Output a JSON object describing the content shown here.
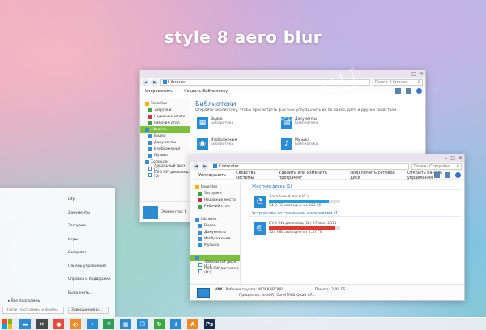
{
  "headline": "style 8 aero blur",
  "watermark": "All4os.RU",
  "libraries_window": {
    "address": "Libraries",
    "search_placeholder": "Поиск: Libraries",
    "commands": [
      "Упорядочить",
      "Создать библиотеку"
    ],
    "nav": [
      {
        "label": "Favorites",
        "icon": "star-icon",
        "level": 0
      },
      {
        "label": "Загрузки",
        "icon": "download-icon",
        "level": 1
      },
      {
        "label": "Недавние места",
        "icon": "recent-places-icon",
        "level": 1
      },
      {
        "label": "Рабочий стол",
        "icon": "desktop-icon",
        "level": 1
      },
      {
        "label": "Libraries",
        "icon": "library-icon",
        "level": 0,
        "selected": true
      },
      {
        "label": "Видео",
        "icon": "video-icon",
        "level": 1
      },
      {
        "label": "Документы",
        "icon": "documents-icon",
        "level": 1
      },
      {
        "label": "Изображения",
        "icon": "pictures-icon",
        "level": 1
      },
      {
        "label": "Музыка",
        "icon": "music-icon",
        "level": 1
      },
      {
        "label": "Computer",
        "icon": "computer-icon",
        "level": 0
      },
      {
        "label": "Локальный диск (C:)",
        "icon": "drive-icon",
        "level": 1
      },
      {
        "label": "DVD RW дисковод (D:)",
        "icon": "dvd-icon",
        "level": 1
      }
    ],
    "heading": "Библиотеки",
    "description": "Откройте библиотеку, чтобы просмотреть файлы и упорядочить их по папке, дате и другим свойствам.",
    "tiles": [
      {
        "name": "Видео",
        "type": "Библиотека",
        "icon": "video-icon",
        "glyph": "▦"
      },
      {
        "name": "Документы",
        "type": "Библиотека",
        "icon": "documents-icon",
        "glyph": "▤"
      },
      {
        "name": "Изображения",
        "type": "Библиотека",
        "icon": "pictures-icon",
        "glyph": "◉"
      },
      {
        "name": "Музыка",
        "type": "Библиотека",
        "icon": "music-icon",
        "glyph": "♪"
      }
    ],
    "details": "Элементов: 4"
  },
  "computer_window": {
    "address": "Computer",
    "search_placeholder": "Поиск: Computer",
    "commands": [
      "Упорядочить",
      "Свойства системы",
      "Удалить или изменить программу",
      "Подключить сетевой диск",
      "Открыть панель управления"
    ],
    "nav": [
      {
        "label": "Favorites",
        "icon": "star-icon",
        "level": 0
      },
      {
        "label": "Загрузки",
        "icon": "download-icon",
        "level": 1
      },
      {
        "label": "Недавние места",
        "icon": "recent-places-icon",
        "level": 1
      },
      {
        "label": "Рабочий стол",
        "icon": "desktop-icon",
        "level": 1
      },
      {
        "label": "",
        "icon": "",
        "level": 0
      },
      {
        "label": "Libraries",
        "icon": "library-icon",
        "level": 0
      },
      {
        "label": "Видео",
        "icon": "video-icon",
        "level": 1
      },
      {
        "label": "Документы",
        "icon": "documents-icon",
        "level": 1
      },
      {
        "label": "Изображения",
        "icon": "pictures-icon",
        "level": 1
      },
      {
        "label": "Музыка",
        "icon": "music-icon",
        "level": 1
      },
      {
        "label": "",
        "icon": "",
        "level": 0
      },
      {
        "label": "",
        "icon": "computer-icon",
        "level": 0,
        "selected": true
      },
      {
        "label": "Локальный диск (C:)",
        "icon": "drive-icon",
        "level": 1
      },
      {
        "label": "DVD RW дисковод (D:)",
        "icon": "dvd-icon",
        "level": 1
      }
    ],
    "groups": [
      {
        "title": "Жесткие диски (1)",
        "drives": [
          {
            "name": "Локальный диск (C:)",
            "space": "34,9 ГБ свободно из 222 ГБ",
            "fill": 0.84,
            "fill_color": "#26a0da",
            "icon": "hard-drive-icon",
            "glyph": "◔"
          }
        ]
      },
      {
        "title": "Устройства со съемными носителями (1)",
        "drives": [
          {
            "name": "DVD RW дисковод (D:) 27 июл 2011",
            "space": "324 МБ свободно из 4,37 ГБ",
            "fill": 0.93,
            "fill_color": "#e0382b",
            "icon": "dvd-drive-icon",
            "glyph": "◎"
          }
        ]
      }
    ],
    "details": {
      "pc_name": "VAY",
      "workgroup": "Рабочая группа: WORKGROUP",
      "memory": "Память: 2,00 ГБ",
      "processor": "Процессор: Intel(R) Core(TM)2 Quad CP..."
    }
  },
  "start_menu": {
    "right_items": [
      "Lity",
      "Документы",
      "Загрузки",
      "Игры",
      "Computer",
      "Панель управления",
      "Справка и поддержка",
      "Выполнить..."
    ],
    "all_programs": "Все программы",
    "search_placeholder": "Найти программы и файлы",
    "shutdown": "Завершение р..."
  },
  "taskbar": {
    "start_colors": [
      "#f25022",
      "#7fba00",
      "#00a4ef",
      "#ffb900"
    ],
    "items": [
      {
        "icon": "explorer-icon",
        "color": "#2b8bd3",
        "glyph": "▬"
      },
      {
        "icon": "tools-icon",
        "color": "#4a4a4a",
        "glyph": "✕"
      },
      {
        "icon": "paint-icon",
        "color": "#e54b3c",
        "glyph": "●"
      },
      {
        "icon": "firefox-icon",
        "color": "#f08a24",
        "glyph": "◐"
      },
      {
        "icon": "run-icon",
        "color": "#2b8bd3",
        "glyph": "✦"
      },
      {
        "icon": "search-icon",
        "color": "#2e9e55",
        "glyph": "⚲"
      },
      {
        "icon": "apps-icon",
        "color": "#2b8bd3",
        "glyph": "▦"
      },
      {
        "icon": "window-icon",
        "color": "#2b8bd3",
        "glyph": "❐"
      },
      {
        "icon": "refresh-icon",
        "color": "#3aa845",
        "glyph": "↻"
      },
      {
        "icon": "download-icon",
        "color": "#2b8bd3",
        "glyph": "↓"
      },
      {
        "icon": "acrobat-icon",
        "color": "#f08a24",
        "glyph": "A"
      },
      {
        "icon": "photoshop-icon",
        "color": "#1c2e4f",
        "glyph": "Ps"
      }
    ]
  }
}
